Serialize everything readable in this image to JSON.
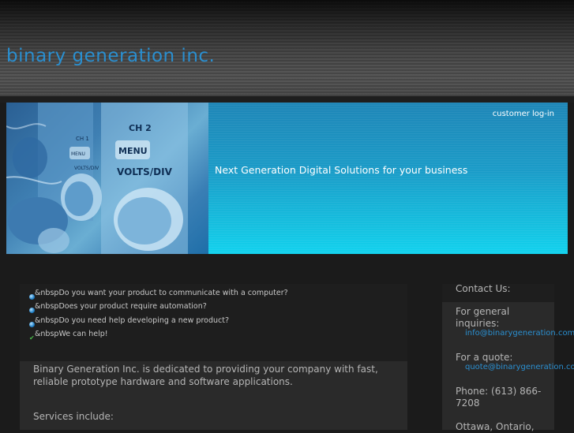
{
  "header": {
    "site_title": "binary generation inc."
  },
  "banner": {
    "login_link": "customer log-in",
    "tagline": "Next Generation Digital Solutions for your business"
  },
  "main": {
    "questions": [
      {
        "text": "&nbspDo you want your product to communicate with a computer?",
        "icon": "blue-dot-bullet-icon"
      },
      {
        "text": "&nbspDoes your product require automation?",
        "icon": "blue-dot-bullet-icon"
      },
      {
        "text": "&nbspDo you need help developing a new product?",
        "icon": "blue-dot-bullet-icon"
      },
      {
        "text": "&nbspWe can help!",
        "icon": "green-check-icon"
      }
    ],
    "intro": "Binary Generation Inc. is dedicated to providing your company with fast, reliable prototype hardware and software applications.",
    "services_heading": "Services include:"
  },
  "sidebar": {
    "heading": "Contact Us:",
    "general_label": "For general inquiries:",
    "general_email": "info@binarygeneration.com",
    "quote_label": "For a quote:",
    "quote_email": "quote@binarygeneration.com",
    "phone": "Phone: (613) 866-7208",
    "location": "Ottawa, Ontario,"
  },
  "colors": {
    "link_blue": "#2a8fd0",
    "banner_cyan": "#12d2ee",
    "check_green": "#49b94a"
  }
}
